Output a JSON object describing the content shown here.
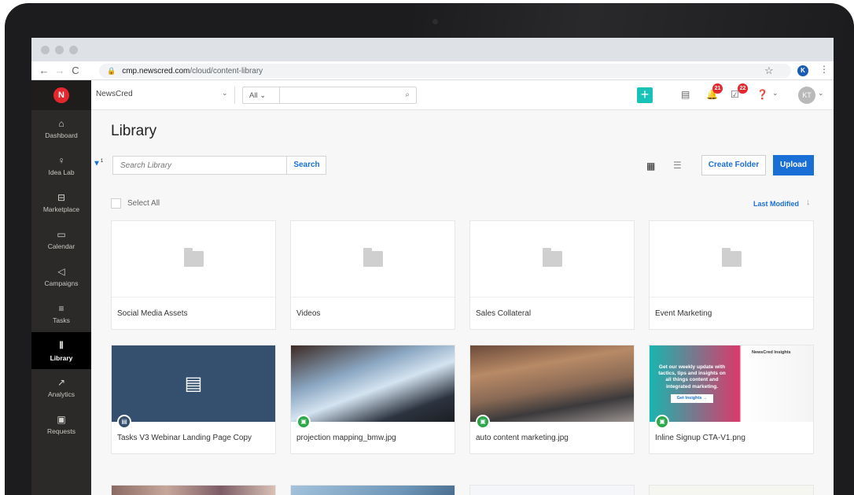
{
  "browser": {
    "url_host": "cmp.newscred.com",
    "url_path": "/cloud/content-library",
    "profile_initial": "K"
  },
  "sidebar": {
    "items": [
      {
        "label": "Dashboard",
        "icon": "home-icon"
      },
      {
        "label": "Idea Lab",
        "icon": "lightbulb-icon"
      },
      {
        "label": "Marketplace",
        "icon": "store-icon"
      },
      {
        "label": "Calendar",
        "icon": "calendar-icon"
      },
      {
        "label": "Campaigns",
        "icon": "megaphone-icon"
      },
      {
        "label": "Tasks",
        "icon": "list-icon"
      },
      {
        "label": "Library",
        "icon": "library-icon"
      },
      {
        "label": "Analytics",
        "icon": "trend-icon"
      },
      {
        "label": "Requests",
        "icon": "request-icon"
      }
    ],
    "active": "Library"
  },
  "topbar": {
    "workspace": "NewsCred",
    "search_scope": "All",
    "notifications_count": "21",
    "tasks_count": "22",
    "avatar_initials": "KT"
  },
  "library": {
    "title": "Library",
    "filter_count": "1",
    "search_placeholder": "Search Library",
    "search_button": "Search",
    "create_folder": "Create Folder",
    "upload": "Upload",
    "select_all": "Select All",
    "sort_label": "Last Modified"
  },
  "folders": [
    {
      "name": "Social Media Assets"
    },
    {
      "name": "Videos"
    },
    {
      "name": "Sales Collateral"
    },
    {
      "name": "Event Marketing"
    }
  ],
  "assets": [
    {
      "name": "Tasks V3 Webinar Landing Page Copy",
      "kind": "article"
    },
    {
      "name": "projection mapping_bmw.jpg",
      "kind": "image"
    },
    {
      "name": "auto content marketing.jpg",
      "kind": "image"
    },
    {
      "name": "Inline Signup CTA-V1.png",
      "kind": "image"
    }
  ],
  "promo": {
    "headline": "Get our weekly update with tactics, tips and insights on all things content and integrated marketing.",
    "cta": "Get Insights →",
    "brand": "NewsCred Insights"
  },
  "colors": {
    "accent": "#1a6fd6",
    "teal": "#19c2b9",
    "badge": "#e4272d",
    "sidebar": "#2b2a28",
    "article_tile": "#34506e",
    "image_chip": "#2aa84a"
  }
}
